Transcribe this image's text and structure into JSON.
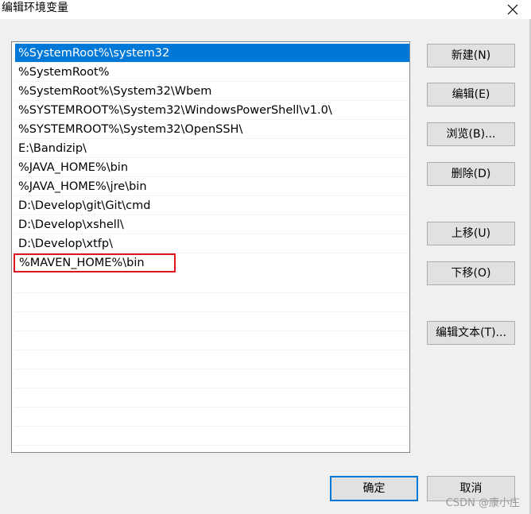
{
  "window": {
    "title": "编辑环境变量",
    "close_icon": "close-icon"
  },
  "path_list": {
    "items": [
      "%SystemRoot%\\system32",
      "%SystemRoot%",
      "%SystemRoot%\\System32\\Wbem",
      "%SYSTEMROOT%\\System32\\WindowsPowerShell\\v1.0\\",
      "%SYSTEMROOT%\\System32\\OpenSSH\\",
      "E:\\Bandizip\\",
      "%JAVA_HOME%\\bin",
      "%JAVA_HOME%\\jre\\bin",
      "D:\\Develop\\git\\Git\\cmd",
      "D:\\Develop\\xshell\\",
      "D:\\Develop\\xtfp\\",
      "%MAVEN_HOME%\\bin"
    ],
    "selected_index": 0,
    "highlighted_index": 11
  },
  "buttons": {
    "new": "新建(N)",
    "edit": "编辑(E)",
    "browse": "浏览(B)...",
    "delete": "删除(D)",
    "move_up": "上移(U)",
    "move_down": "下移(O)",
    "edit_text": "编辑文本(T)...",
    "ok": "确定",
    "cancel": "取消"
  },
  "watermark": "CSDN @康小庄",
  "colors": {
    "selection": "#0078d7",
    "highlight_border": "#e0141e"
  }
}
